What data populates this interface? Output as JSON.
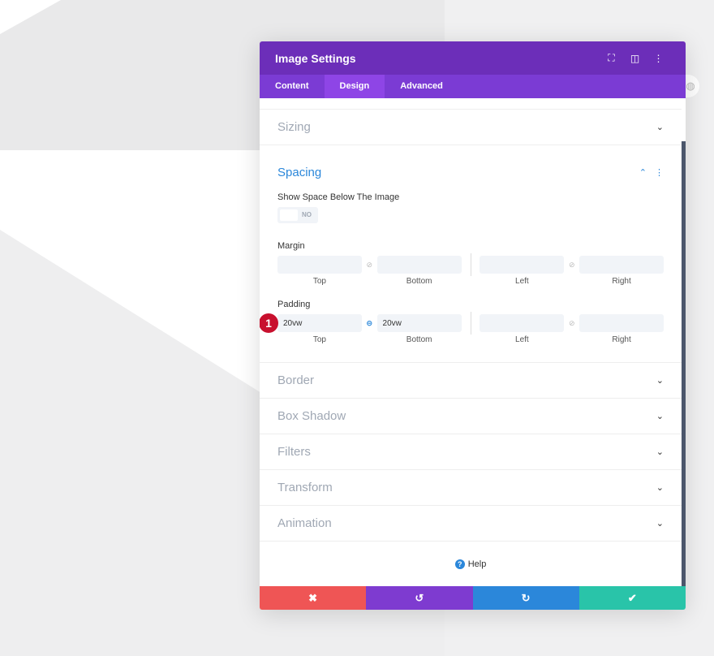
{
  "header": {
    "title": "Image Settings"
  },
  "tabs": [
    {
      "label": "Content"
    },
    {
      "label": "Design"
    },
    {
      "label": "Advanced"
    }
  ],
  "sections": {
    "sizing": "Sizing",
    "spacing": "Spacing",
    "border": "Border",
    "box_shadow": "Box Shadow",
    "filters": "Filters",
    "transform": "Transform",
    "animation": "Animation"
  },
  "spacing": {
    "show_space_label": "Show Space Below The Image",
    "toggle_value": "NO",
    "margin_label": "Margin",
    "padding_label": "Padding",
    "captions": [
      "Top",
      "Bottom",
      "Left",
      "Right"
    ],
    "margin": {
      "top": "",
      "bottom": "",
      "left": "",
      "right": ""
    },
    "padding": {
      "top": "20vw",
      "bottom": "20vw",
      "left": "",
      "right": ""
    },
    "badge": "1"
  },
  "help": "Help",
  "footer": {
    "cancel": "✖",
    "undo": "↺",
    "redo": "↻",
    "save": "✔"
  },
  "colors": {
    "header": "#6c2eb9",
    "tabs": "#7b3bd4",
    "cancel": "#ef5555",
    "undo": "#7e3bd0",
    "redo": "#2b87da",
    "save": "#29c4a9"
  }
}
